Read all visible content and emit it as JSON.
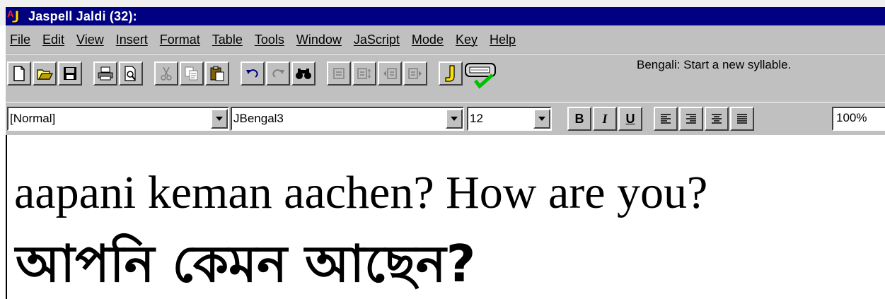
{
  "window": {
    "title": "Jaspell Jaldi (32):"
  },
  "menu": [
    "File",
    "Edit",
    "View",
    "Insert",
    "Format",
    "Table",
    "Tools",
    "Window",
    "JaScript",
    "Mode",
    "Key",
    "Help"
  ],
  "toolbar": {
    "icons": [
      "new-document-icon",
      "open-folder-icon",
      "save-icon",
      "print-icon",
      "print-preview-icon",
      "cut-icon",
      "copy-icon",
      "paste-icon",
      "undo-icon",
      "redo-icon",
      "find-icon",
      "align-a-icon",
      "align-b-icon",
      "indent-decrease-icon",
      "indent-increase-icon",
      "jaspell-icon",
      "keyboard-check-icon"
    ],
    "status": "Bengali:  Start a new syllable."
  },
  "format": {
    "style": "[Normal]",
    "font": "JBengal3",
    "size": "12",
    "bold": "B",
    "italic": "I",
    "underline": "U",
    "zoom": "100%"
  },
  "document": {
    "line1": "aapani keman aachen?   How are you?",
    "line2": "আপনি কেমন আছেন?"
  }
}
